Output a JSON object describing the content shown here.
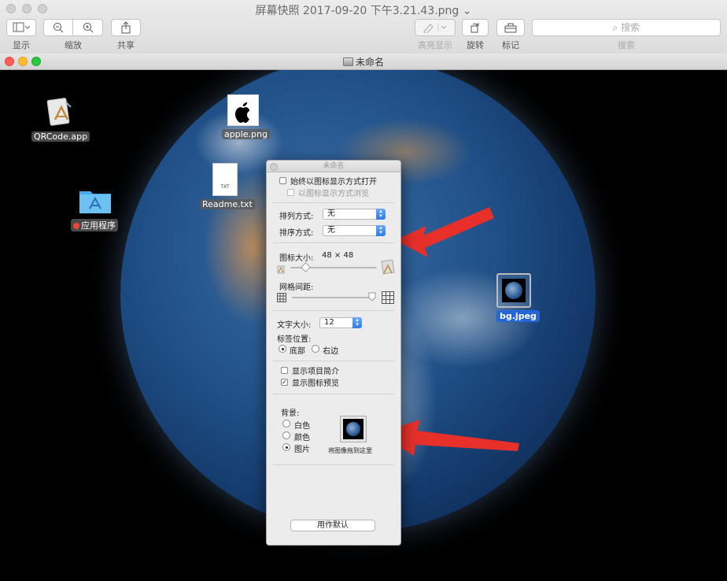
{
  "preview": {
    "title": "屏幕快照 2017-09-20 下午3.21.43.png ⌄",
    "toolbar": {
      "display": "显示",
      "zoom": "缩放",
      "share": "共享",
      "highlight": "高亮显示",
      "rotate": "旋转",
      "markup": "标记",
      "search": "搜索",
      "search_placeholder": "搜索"
    }
  },
  "window": {
    "title": "未命名"
  },
  "desktop_icons": {
    "qrcode": "QRCode.app",
    "apple": "apple.png",
    "readme": "Readme.txt",
    "readme_badge": "TXT",
    "apps": "应用程序",
    "bg": "bg.jpeg"
  },
  "inspector": {
    "title": "未命名",
    "always_icon_view": "始终以图标显示方式打开",
    "browse_icon_view": "以图标显示方式浏览",
    "arrange_label": "排列方式:",
    "arrange_value": "无",
    "sort_label": "排序方式:",
    "sort_value": "无",
    "icon_size_label": "图标大小:",
    "icon_size_value": "48 × 48",
    "grid_spacing_label": "网格间距:",
    "text_size_label": "文字大小:",
    "text_size_value": "12",
    "label_position_label": "标签位置:",
    "label_bottom": "底部",
    "label_right": "右边",
    "show_item_info": "显示项目简介",
    "show_icon_preview": "显示图标预览",
    "background_label": "背景:",
    "bg_white": "白色",
    "bg_color": "颜色",
    "bg_picture": "图片",
    "drop_hint": "将图像拖到这里",
    "use_defaults": "用作默认",
    "icon_size_fraction": 0.1,
    "grid_spacing_fraction": 1.0
  },
  "colors": {
    "arrow": "#e8302a",
    "selection": "#2466d8",
    "popup_accent": "#2f7ce8"
  }
}
